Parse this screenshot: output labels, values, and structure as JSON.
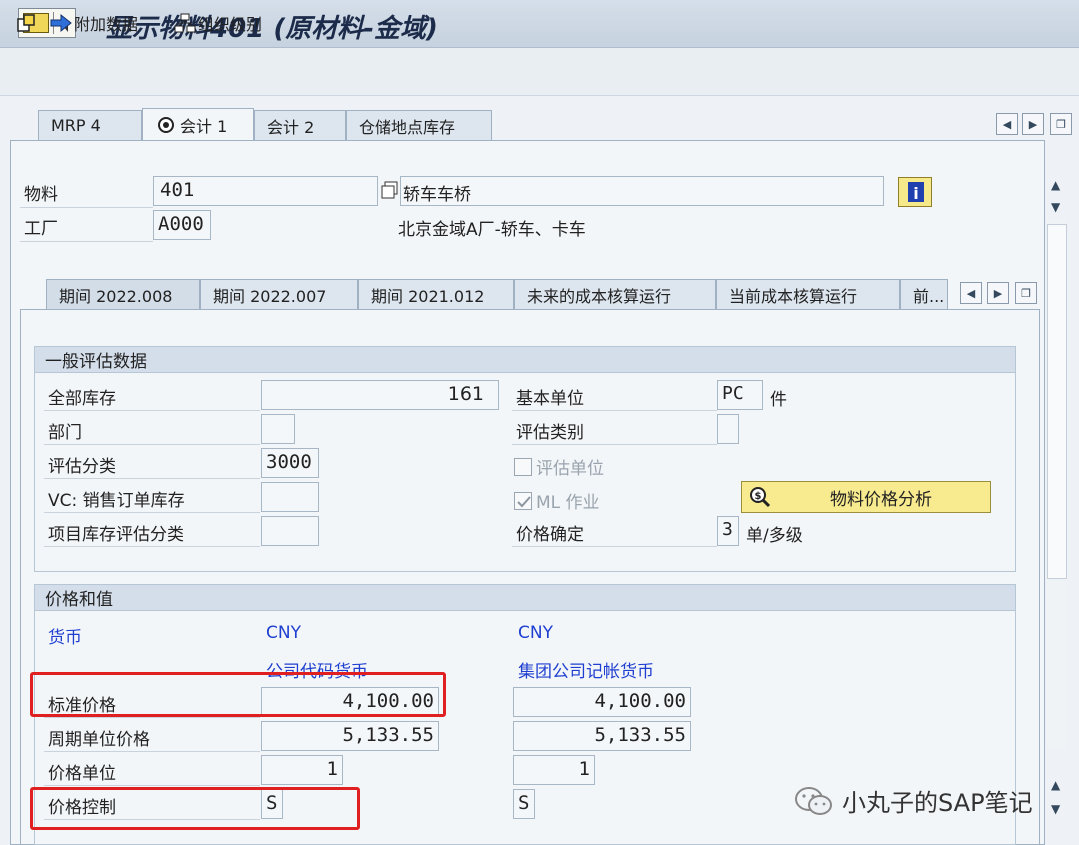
{
  "window": {
    "title": "显示物料401 (原材料-金域)"
  },
  "toolbar": {
    "additional_data": "附加数据",
    "org_levels": "组织级别"
  },
  "tabs": [
    "MRP 4",
    "会计 1",
    "会计 2",
    "仓储地点库存"
  ],
  "header": {
    "material_label": "物料",
    "material_value": "401",
    "material_desc": "轿车车桥",
    "plant_label": "工厂",
    "plant_value": "A000",
    "plant_desc": "北京金域A厂-轿车、卡车"
  },
  "period_tabs": [
    "期间 2022.008",
    "期间 2022.007",
    "期间 2021.012",
    "未来的成本核算运行",
    "当前成本核算运行",
    "前..."
  ],
  "general_valuation": {
    "title": "一般评估数据",
    "total_stock_label": "全部库存",
    "total_stock_value": "161",
    "base_unit_label": "基本单位",
    "base_unit_value": "PC",
    "base_unit_desc": "件",
    "division_label": "部门",
    "division_value": "",
    "valuation_category_label": "评估类别",
    "valuation_category_value": "",
    "valuation_class_label": "评估分类",
    "valuation_class_value": "3000",
    "valuated_unit_label": "评估单位",
    "vc_label": "VC: 销售订单库存",
    "vc_value": "",
    "ml_label": "ML 作业",
    "project_stock_label": "项目库存评估分类",
    "project_stock_value": "",
    "price_determination_label": "价格确定",
    "price_determination_value": "3",
    "price_determination_desc": "单/多级",
    "price_analysis_button": "物料价格分析"
  },
  "prices": {
    "title": "价格和值",
    "currency_label": "货币",
    "currency_col1": "CNY",
    "currency_col2": "CNY",
    "col1_header": "公司代码货币",
    "col2_header": "集团公司记帐货币",
    "standard_price_label": "标准价格",
    "standard_price_1": "4,100.00",
    "standard_price_2": "4,100.00",
    "periodic_price_label": "周期单位价格",
    "periodic_price_1": "5,133.55",
    "periodic_price_2": "5,133.55",
    "price_unit_label": "价格单位",
    "price_unit_1": "1",
    "price_unit_2": "1",
    "price_control_label": "价格控制",
    "price_control_1": "S",
    "price_control_2": "S"
  },
  "watermark": "小丸子的SAP笔记",
  "colors": {
    "highlight": "#e02020",
    "blue_text": "#1f3fd0",
    "yellow_button": "#f8ea8e"
  }
}
